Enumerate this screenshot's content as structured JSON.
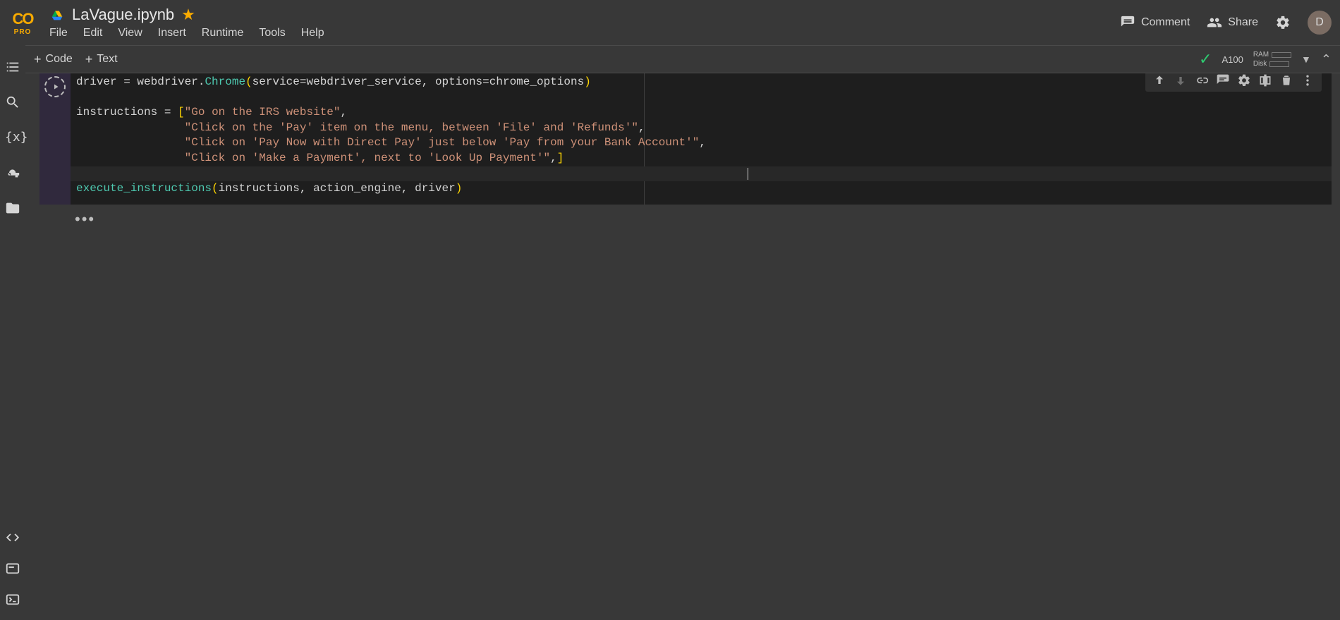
{
  "logo": {
    "pro": "PRO"
  },
  "file": {
    "name": "LaVague.ipynb"
  },
  "menus": {
    "file": "File",
    "edit": "Edit",
    "view": "View",
    "insert": "Insert",
    "runtime": "Runtime",
    "tools": "Tools",
    "help": "Help"
  },
  "header_actions": {
    "comment": "Comment",
    "share": "Share"
  },
  "avatar_letter": "D",
  "toolbar": {
    "code": "Code",
    "text": "Text"
  },
  "runtime": {
    "accelerator": "A100",
    "ram_label": "RAM",
    "disk_label": "Disk"
  },
  "code": {
    "l1a": "driver ",
    "l1b": "=",
    "l1c": " webdriver",
    "l1d": ".",
    "l1e": "Chrome",
    "l1f": "(",
    "l1g": "service",
    "l1h": "=",
    "l1i": "webdriver_service",
    "l1j": ", ",
    "l1k": "options",
    "l1l": "=",
    "l1m": "chrome_options",
    "l1n": ")",
    "l3a": "instructions ",
    "l3b": "=",
    "l3c": " ",
    "l3d": "[",
    "l3e": "\"Go on the IRS website\"",
    "l3f": ",",
    "l4a": "                ",
    "l4b": "\"Click on the 'Pay' item on the menu, between 'File' and 'Refunds'\"",
    "l4c": ",",
    "l5a": "                ",
    "l5b": "\"Click on 'Pay Now with Direct Pay' just below 'Pay from your Bank Account'\"",
    "l5c": ",",
    "l6a": "                ",
    "l6b": "\"Click on 'Make a Payment', next to 'Look Up Payment'\"",
    "l6c": ",",
    "l6d": "]",
    "l8a": "execute_instructions",
    "l8b": "(",
    "l8c": "instructions",
    "l8d": ", ",
    "l8e": "action_engine",
    "l8f": ", ",
    "l8g": "driver",
    "l8h": ")"
  }
}
